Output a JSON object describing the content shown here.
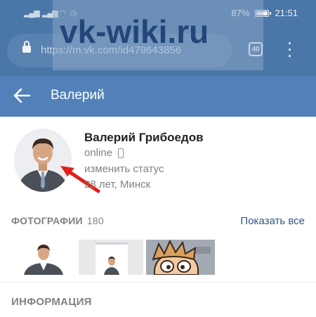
{
  "status_bar": {
    "battery": "87%",
    "time": "21:51"
  },
  "browser": {
    "url": "https://m.vk.com/id479643856",
    "tab_count": "40"
  },
  "watermark": {
    "text": "vk-wiki.ru"
  },
  "appbar": {
    "title": "Валерий"
  },
  "profile": {
    "name": "Валерий Грибоедов",
    "online": "online",
    "status_action": "изменить статус",
    "age_city": "28 лет, Минск"
  },
  "photos": {
    "title": "ФОТОГРАФИИ",
    "count": "180",
    "show_all": "Показать все"
  },
  "info": {
    "title": "ИНФОРМАЦИЯ"
  },
  "colors": {
    "vk_blue": "#5181b8",
    "browser_blue": "#4a76a8",
    "link": "#2a5885",
    "arrow_red": "#e0211a"
  }
}
